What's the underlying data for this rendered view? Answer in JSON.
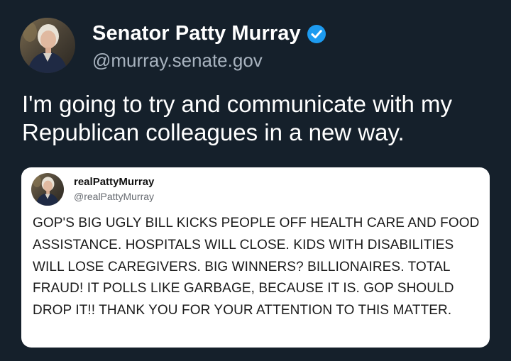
{
  "post": {
    "author_name": "Senator Patty Murray",
    "author_handle": "@murray.senate.gov",
    "verified_icon": "verified-badge-icon",
    "text": "I'm going to try and communicate with my Republican colleagues in a new way."
  },
  "quote": {
    "author_name": "realPattyMurray",
    "author_handle": "@realPattyMurray",
    "text": "GOP'S BIG UGLY BILL KICKS PEOPLE OFF HEALTH CARE AND FOOD ASSISTANCE. HOSPITALS WILL CLOSE. KIDS WITH DISABILITIES WILL LOSE CAREGIVERS. BIG WINNERS? BILLIONAIRES. TOTAL FRAUD! IT POLLS LIKE GARBAGE, BECAUSE IT IS. GOP SHOULD DROP IT!! THANK YOU FOR YOUR ATTENTION TO THIS MATTER."
  },
  "colors": {
    "background": "#15202b",
    "verified_blue": "#1d9bf0",
    "handle_gray": "#a8b3bf",
    "card_background": "#ffffff"
  }
}
